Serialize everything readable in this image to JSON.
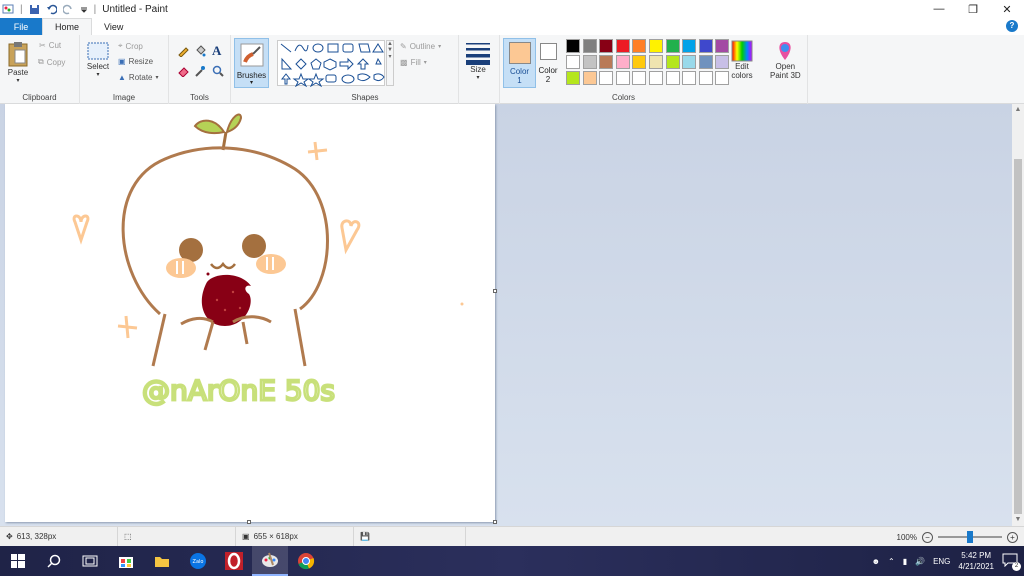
{
  "window": {
    "title": "Untitled - Paint",
    "quick_access": [
      "paint-app-icon",
      "save-icon",
      "undo-icon",
      "redo-icon",
      "customize-icon"
    ],
    "controls": [
      "minimize-icon",
      "restore-icon",
      "close-icon"
    ]
  },
  "tabs": [
    {
      "label": "File",
      "active": false
    },
    {
      "label": "Home",
      "active": true
    },
    {
      "label": "View",
      "active": false
    }
  ],
  "ribbon": {
    "clipboard": {
      "label": "Clipboard",
      "paste": "Paste",
      "cut": "Cut",
      "copy": "Copy"
    },
    "image": {
      "label": "Image",
      "select": "Select",
      "crop": "Crop",
      "resize": "Resize",
      "rotate": "Rotate"
    },
    "tools": {
      "label": "Tools"
    },
    "brushes": {
      "label": "Brushes"
    },
    "shapes": {
      "label": "Shapes",
      "outline": "Outline",
      "fill": "Fill"
    },
    "size": {
      "label": "Size"
    },
    "colors": {
      "label": "Colors",
      "color1_label": "Color\n1",
      "color2_label": "Color\n2",
      "color1_value": "#fcc894",
      "color2_value": "#ffffff",
      "edit_colors": "Edit\ncolors",
      "open_paint3d": "Open\nPaint 3D",
      "palette_row1": [
        "#000000",
        "#7f7f7f",
        "#880015",
        "#ed1c24",
        "#ff7f27",
        "#fff200",
        "#22b14c",
        "#00a2e8",
        "#3f48cc",
        "#a349a4"
      ],
      "palette_row2": [
        "#ffffff",
        "#c3c3c3",
        "#b97a57",
        "#ffaec9",
        "#ffc90e",
        "#efe4b0",
        "#b5e61d",
        "#99d9ea",
        "#7092be",
        "#c8bfe7"
      ],
      "palette_row3": [
        "#b5e61d",
        "#fcc894",
        "#ffffff",
        "#ffffff",
        "#ffffff",
        "#ffffff",
        "#ffffff",
        "#ffffff",
        "#ffffff",
        "#ffffff"
      ]
    }
  },
  "drawing": {
    "signature_text": "@nArOnE 50s"
  },
  "status": {
    "cursor_pos": "613, 328px",
    "image_size": "655 × 618px",
    "zoom": "100%",
    "zoom_fraction": 0.5
  },
  "taskbar": {
    "apps": [
      "windows-start-icon",
      "search-icon",
      "task-view-icon",
      "store-icon",
      "file-explorer-icon",
      "zalo-icon",
      "opera-icon",
      "paint-icon",
      "chrome-icon"
    ],
    "lang": "ENG",
    "time": "5:42 PM",
    "date": "4/21/2021",
    "notification_count": "2"
  }
}
